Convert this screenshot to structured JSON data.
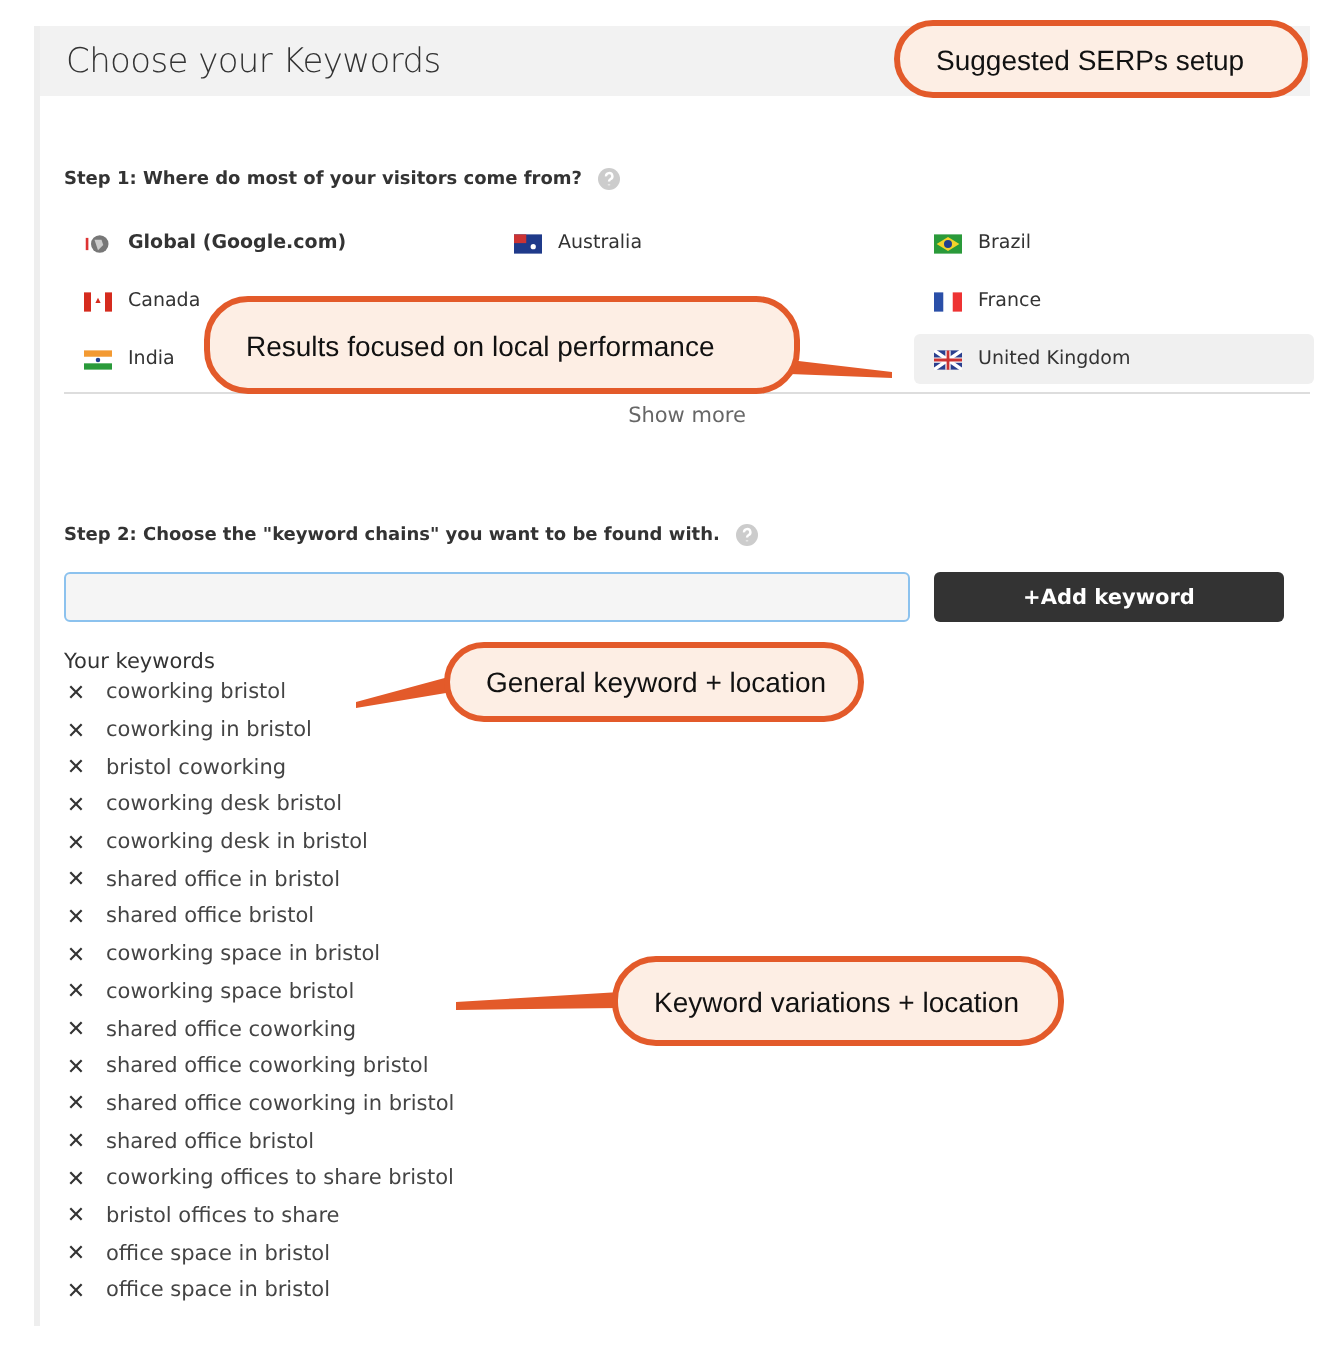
{
  "header": {
    "title": "Choose your Keywords"
  },
  "step1": {
    "label": "Step 1: Where do most of your visitors come from?",
    "countries": [
      {
        "name": "Global (Google.com)",
        "selected": false,
        "kind": "global"
      },
      {
        "name": "Australia",
        "selected": false,
        "kind": "flag"
      },
      {
        "name": "Brazil",
        "selected": false,
        "kind": "flag"
      },
      {
        "name": "Canada",
        "selected": false,
        "kind": "flag"
      },
      {
        "name": "France",
        "selected": false,
        "kind": "flag"
      },
      {
        "name": "India",
        "selected": false,
        "kind": "flag"
      },
      {
        "name": "United Kingdom",
        "selected": true,
        "kind": "flag"
      }
    ],
    "show_more": "Show more"
  },
  "step2": {
    "label": "Step 2: Choose the \"keyword chains\" you want to be found with.",
    "add_button": "+Add keyword"
  },
  "keywords": {
    "title": "Your keywords",
    "remove_icon": "✕",
    "items": [
      "coworking bristol",
      "coworking in bristol",
      "bristol coworking",
      "coworking desk bristol",
      "coworking desk in bristol",
      "shared office in bristol",
      "shared office bristol",
      "coworking space in bristol",
      "coworking space bristol",
      "shared office coworking",
      "shared office coworking bristol",
      "shared office coworking in bristol",
      "shared office bristol",
      "coworking offices to share bristol",
      "bristol offices to share",
      "office space in bristol",
      "office space in bristol"
    ]
  },
  "callouts": [
    "Suggested SERPs setup",
    "Results focused on local performance",
    "General keyword + location",
    "Keyword variations + location"
  ]
}
